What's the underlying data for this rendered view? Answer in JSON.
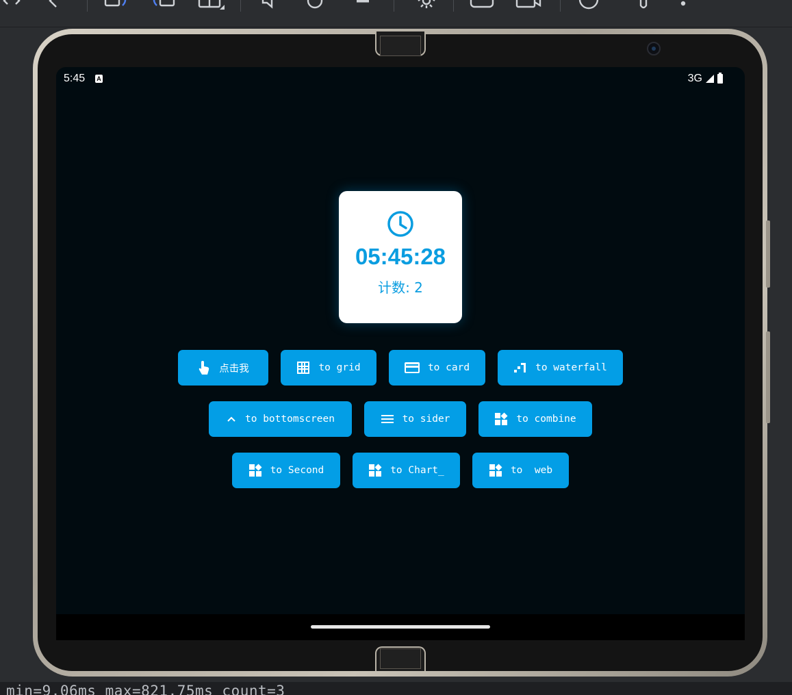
{
  "toolbar": {
    "icons": [
      "code-arrows-icon",
      "back-arrow-icon",
      "rotate-left-icon",
      "rotate-right-icon",
      "fold-icon",
      "volume-icon",
      "power-icon",
      "stop-icon",
      "settings-icon",
      "screenshot-icon",
      "screen-record-icon",
      "help-icon",
      "touch-icon",
      "more-icon"
    ]
  },
  "status_bar": {
    "time": "5:45",
    "keyboard_badge": "A",
    "network": "3G"
  },
  "clock_card": {
    "time": "05:45:28",
    "count_text": "计数: 2"
  },
  "buttons": [
    {
      "label": "点击我",
      "icon": "touch-icon"
    },
    {
      "label": "to grid",
      "icon": "grid-icon"
    },
    {
      "label": "to card",
      "icon": "card-icon"
    },
    {
      "label": "to waterfall",
      "icon": "waterfall-icon"
    },
    {
      "label": "to bottomscreen",
      "icon": "chevron-up-icon"
    },
    {
      "label": "to sider",
      "icon": "menu-icon"
    },
    {
      "label": "to combine",
      "icon": "widgets-icon"
    },
    {
      "label": "to Second",
      "icon": "widgets-icon"
    },
    {
      "label": "to Chart_",
      "icon": "widgets-icon"
    },
    {
      "label": "to  web",
      "icon": "widgets-icon"
    }
  ],
  "log": {
    "text": "min=9.06ms max=821.75ms count=3"
  },
  "colors": {
    "accent": "#039ee6",
    "clock_text": "#0a9de0",
    "screen_bg": "#010b10",
    "ide_bg": "#2b2d30"
  }
}
